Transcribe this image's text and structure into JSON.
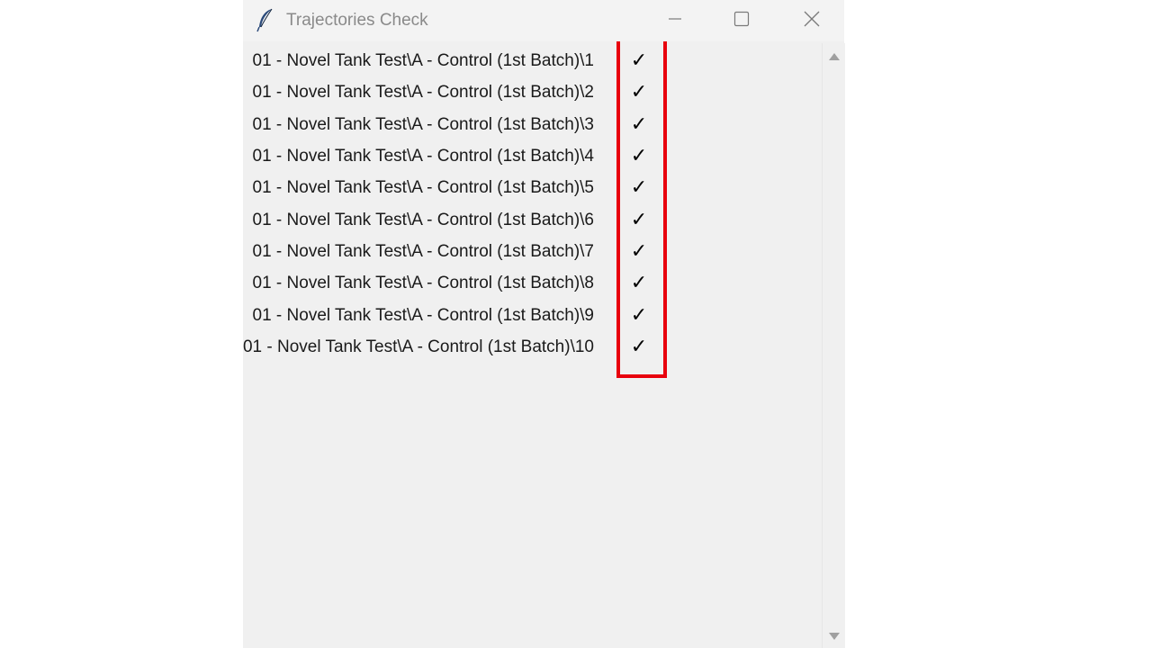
{
  "window": {
    "title": "Trajectories Check",
    "app_icon": "feather-icon",
    "controls": {
      "minimize": "minimize-icon",
      "maximize": "maximize-icon",
      "close": "close-icon"
    }
  },
  "rows": [
    {
      "label": "01 - Novel Tank Test\\A - Control (1st Batch)\\1",
      "check": "✓"
    },
    {
      "label": "01 - Novel Tank Test\\A - Control (1st Batch)\\2",
      "check": "✓"
    },
    {
      "label": "01 - Novel Tank Test\\A - Control (1st Batch)\\3",
      "check": "✓"
    },
    {
      "label": "01 - Novel Tank Test\\A - Control (1st Batch)\\4",
      "check": "✓"
    },
    {
      "label": "01 - Novel Tank Test\\A - Control (1st Batch)\\5",
      "check": "✓"
    },
    {
      "label": "01 - Novel Tank Test\\A - Control (1st Batch)\\6",
      "check": "✓"
    },
    {
      "label": "01 - Novel Tank Test\\A - Control (1st Batch)\\7",
      "check": "✓"
    },
    {
      "label": "01 - Novel Tank Test\\A - Control (1st Batch)\\8",
      "check": "✓"
    },
    {
      "label": "01 - Novel Tank Test\\A - Control (1st Batch)\\9",
      "check": "✓"
    },
    {
      "label": "01 - Novel Tank Test\\A - Control (1st Batch)\\10",
      "check": "✓"
    }
  ],
  "colors": {
    "highlight": "#e8000d",
    "window_bg": "#f0f0f0",
    "title_text": "#8a8a8a"
  }
}
